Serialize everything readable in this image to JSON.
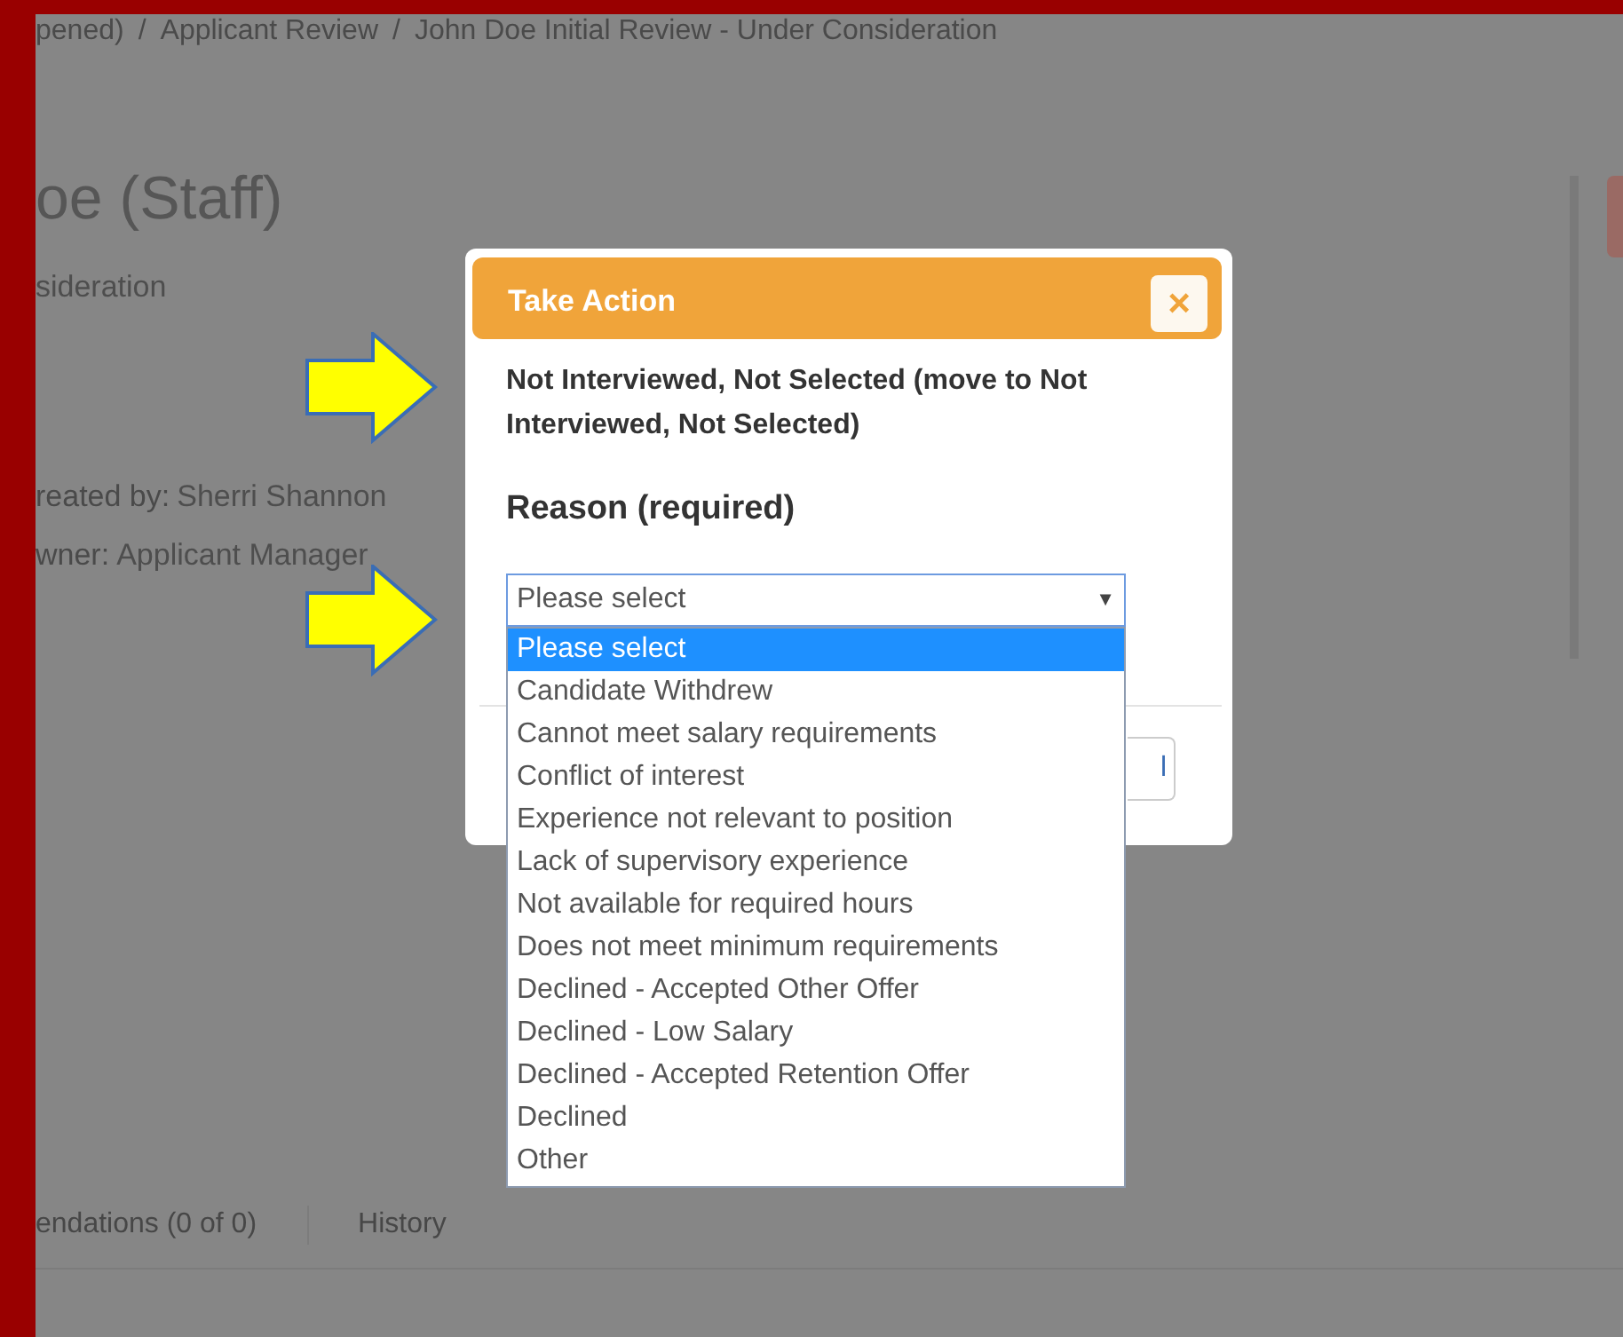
{
  "breadcrumb": [
    "pened)",
    "/",
    "Applicant Review",
    "/",
    "John Doe Initial Review - Under Consideration"
  ],
  "page_title": "oe (Staff)",
  "subtitle": "sideration",
  "details": [
    {
      "label": "reated by:",
      "value": "Sherri Shannon"
    },
    {
      "label": "wner:",
      "value": "Applicant Manager"
    }
  ],
  "tabs": [
    "endations (0 of 0)",
    "History"
  ],
  "dialog": {
    "title": "Take Action",
    "close": "×",
    "message": "Not Interviewed, Not Selected (move to Not Interviewed, Not Selected)",
    "reason_label": "Reason (required)",
    "select": {
      "value": "Please select",
      "arrow": "▼",
      "options": [
        {
          "label": "Please select",
          "selected": true
        },
        {
          "label": "Candidate Withdrew",
          "selected": false
        },
        {
          "label": "Cannot meet salary requirements",
          "selected": false
        },
        {
          "label": "Conflict of interest",
          "selected": false
        },
        {
          "label": "Experience not relevant to position",
          "selected": false
        },
        {
          "label": "Lack of supervisory experience",
          "selected": false
        },
        {
          "label": "Not available for required hours",
          "selected": false
        },
        {
          "label": "Does not meet minimum requirements",
          "selected": false
        },
        {
          "label": "Declined - Accepted Other Offer",
          "selected": false
        },
        {
          "label": "Declined - Low Salary",
          "selected": false
        },
        {
          "label": "Declined - Accepted Retention Offer",
          "selected": false
        },
        {
          "label": "Declined",
          "selected": false
        },
        {
          "label": "Other",
          "selected": false
        }
      ]
    },
    "footer_button": "l"
  }
}
